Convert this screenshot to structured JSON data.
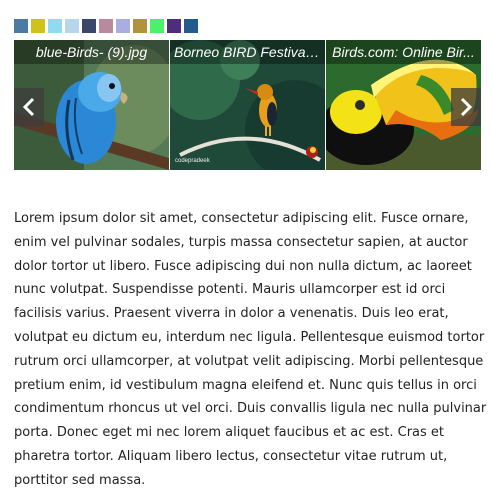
{
  "swatches": [
    {
      "name": "steel-blue",
      "color": "#4b7ba3"
    },
    {
      "name": "olive-yellow",
      "color": "#cfc21a"
    },
    {
      "name": "light-cyan",
      "color": "#8fdcf0"
    },
    {
      "name": "pale-blue",
      "color": "#b7d6ea"
    },
    {
      "name": "dark-slate",
      "color": "#3a476a"
    },
    {
      "name": "mauve",
      "color": "#b98a9c"
    },
    {
      "name": "lavender",
      "color": "#a9aee0"
    },
    {
      "name": "khaki",
      "color": "#b1933e"
    },
    {
      "name": "bright-green",
      "color": "#4cf16a"
    },
    {
      "name": "purple",
      "color": "#4c2e7c"
    },
    {
      "name": "deep-blue",
      "color": "#235b8f"
    }
  ],
  "carousel": {
    "prev_icon": "chevron-left-icon",
    "next_icon": "chevron-right-icon",
    "slides": [
      {
        "caption": "blue-Birds- (9).jpg"
      },
      {
        "caption": "Borneo BIRD Festival ..."
      },
      {
        "caption": "Birds.com: Online Bir..."
      }
    ],
    "watermark": "codepradeek"
  },
  "article": {
    "text": "Lorem ipsum dolor sit amet, consectetur adipiscing elit. Fusce ornare, enim vel pulvinar sodales, turpis massa consectetur sapien, at auctor dolor tortor ut libero. Fusce adipiscing dui non nulla dictum, ac laoreet nunc volutpat. Suspendisse potenti. Mauris ullamcorper est id orci facilisis varius. Praesent viverra in dolor a venenatis. Duis leo erat, volutpat eu dictum eu, interdum nec ligula. Pellentesque euismod tortor rutrum orci ullamcorper, at volutpat velit adipiscing. Morbi pellentesque pretium enim, id vestibulum magna eleifend et. Nunc quis tellus in orci condimentum rhoncus ut vel orci. Duis convallis ligula nec nulla pulvinar porta. Donec eget mi nec lorem aliquet faucibus et ac est. Cras et pharetra tortor. Aliquam libero lectus, consectetur vitae rutrum ut, porttitor sed massa."
  }
}
